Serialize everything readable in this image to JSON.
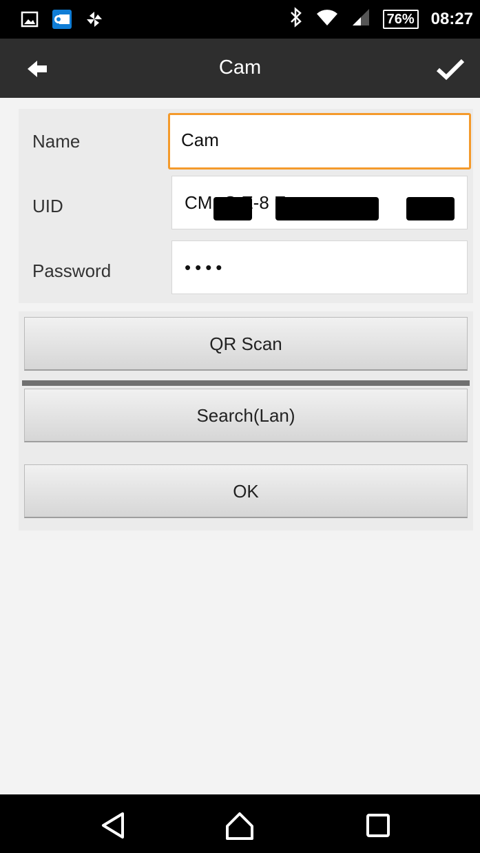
{
  "status_bar": {
    "left_icons": [
      "image-notification-icon",
      "outlook-mail-icon",
      "pinwheel-app-icon"
    ],
    "right_icons": [
      "bluetooth-icon",
      "wifi-icon",
      "cell-signal-icon"
    ],
    "battery": "76%",
    "time": "08:27"
  },
  "action_bar": {
    "title": "Cam",
    "back_icon": "back-arrow-icon",
    "confirm_icon": "checkmark-icon"
  },
  "form": {
    "name_label": "Name",
    "name_value": "Cam",
    "uid_label": "UID",
    "uid_value": "CM      -C              E-8        E",
    "password_label": "Password",
    "password_value": "••••"
  },
  "buttons": {
    "qr_scan": "QR Scan",
    "search_lan": "Search(Lan)",
    "ok": "OK"
  },
  "nav_bar": {
    "back": "back-triangle-icon",
    "home": "home-icon",
    "recents": "recents-square-icon"
  },
  "colors": {
    "focus_border": "#f49a2b",
    "action_bar": "#2e2e2e",
    "background": "#f3f3f3"
  }
}
